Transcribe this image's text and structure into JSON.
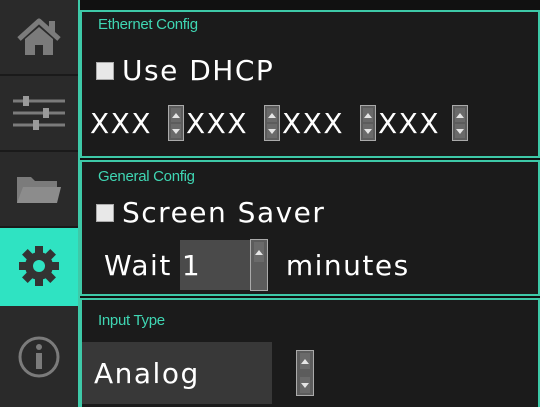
{
  "colors": {
    "accent": "#3ec9a8",
    "accent_active": "#2fe3c2",
    "title_text": "#3fd6b3",
    "panel_bg": "#1b1b1b",
    "sidebar_bg": "#2a2a2a"
  },
  "sidebar": {
    "items": [
      {
        "icon": "home-icon",
        "active": false
      },
      {
        "icon": "sliders-icon",
        "active": false
      },
      {
        "icon": "folder-icon",
        "active": false
      },
      {
        "icon": "gear-icon",
        "active": true
      },
      {
        "icon": "info-icon",
        "active": false
      }
    ]
  },
  "ethernet": {
    "title": "Ethernet Config",
    "dhcp_label": "Use DHCP",
    "ip_octets": [
      "XXX",
      "XXX",
      "XXX",
      "XXX"
    ]
  },
  "general": {
    "title": "General Config",
    "screen_saver_label": "Screen Saver",
    "wait_label": "Wait",
    "wait_value": "1",
    "minutes_label": "minutes"
  },
  "input_type": {
    "title": "Input Type",
    "value": "Analog"
  }
}
